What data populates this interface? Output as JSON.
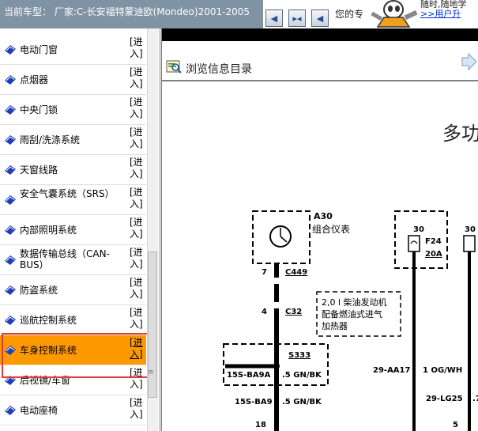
{
  "header": {
    "car_type": "当前车型： 厂家:C-长安福特蒙迪欧(Mondeo)2001-2005",
    "nav_prev": "◀",
    "nav_expand": "▸◂",
    "nav_back": "◀",
    "welcome": "您的专",
    "promo_line1": "随时,随地学",
    "promo_link": ">>用户升"
  },
  "sidebar": {
    "items": [
      {
        "label": "电动门窗",
        "action": "[进\n入]"
      },
      {
        "label": "点烟器",
        "action": "[进\n入]"
      },
      {
        "label": "中央门锁",
        "action": "[进\n入]"
      },
      {
        "label": "雨刮/洗涤系统",
        "action": "[进\n入]"
      },
      {
        "label": "天窗线路",
        "action": "[进\n入]"
      },
      {
        "label": "安全气囊系统（SRS）",
        "action": "[进\n入]"
      },
      {
        "label": "内部照明系统",
        "action": "[进\n入]"
      },
      {
        "label": "数据传输总线（CAN-BUS）",
        "action": "[进\n入]"
      },
      {
        "label": "防盗系统",
        "action": "[进\n入]"
      },
      {
        "label": "巡航控制系统",
        "action": "[进\n入]"
      },
      {
        "label": "车身控制系统",
        "action": "[进\n入]",
        "selected": true
      },
      {
        "label": "后视镜/车窗",
        "action": "[进\n入]"
      },
      {
        "label": "电动座椅",
        "action": "[进\n入]"
      }
    ]
  },
  "toc": {
    "label": "浏览信息目录"
  },
  "diagram": {
    "title": "多功",
    "a30_id": "A30",
    "a30_name": "组合仪表",
    "pin7": "7",
    "c449": "C449",
    "pin4": "4",
    "c32": "C32",
    "note_line1": "2,0 l 柴油发动机",
    "note_line2": "配备燃油式进气",
    "note_line3": "加热器",
    "s333": "S333",
    "w1_code": "15S-BA9A",
    "w1_color": ".5 GN/BK",
    "w2_code": "15S-BA9",
    "w2_color": ".5 GN/BK",
    "pin18": "18",
    "f24_pin": "30",
    "f24": "F24",
    "f24_amp": "20A",
    "f25_pin": "30",
    "aa17_code": "29-AA17",
    "aa17_color": "1 OG/WH",
    "lg25_code": "29-LG25",
    "lg25_color": ".7",
    "pin5": "5"
  },
  "colors": {
    "header_bg": "#7f93a5",
    "selected_bg": "#ff9900",
    "highlight_border": "#e23a3a",
    "bullet_blue": "#1f3fb5"
  }
}
